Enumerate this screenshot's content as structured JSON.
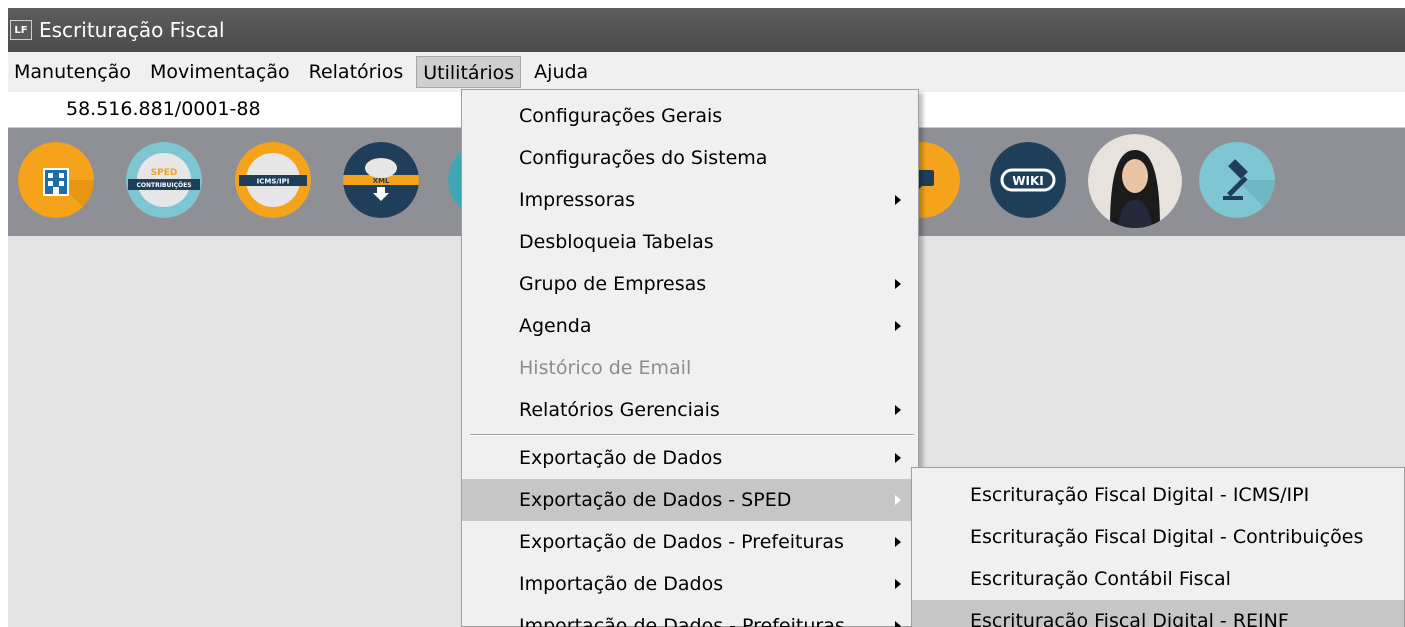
{
  "window": {
    "app_icon_text": "LF",
    "title": "Escrituração Fiscal"
  },
  "menubar": {
    "items": [
      "Manutenção",
      "Movimentação",
      "Relatórios",
      "Utilitários",
      "Ajuda"
    ],
    "active": "Utilitários"
  },
  "company": {
    "cnpj": "58.516.881/0001-88"
  },
  "toolbar": {
    "icons": [
      {
        "name": "building-icon",
        "color": "#f5a31a"
      },
      {
        "name": "sped-contribuicoes-icon",
        "label": "SPED CONTRIBUIÇÕES",
        "color": "#7fc6d3"
      },
      {
        "name": "icms-ipi-icon",
        "label": "ICMS/IPI",
        "color": "#f5a31a"
      },
      {
        "name": "xml-download-icon",
        "label": "XML",
        "color": "#1f3e5a"
      },
      {
        "name": "chat-icon",
        "color": "#f5a31a"
      },
      {
        "name": "wiki-icon",
        "label": "WIKI",
        "color": "#1f3e5a"
      },
      {
        "name": "assistant-avatar-icon",
        "color": "#e6c9a8"
      },
      {
        "name": "gavel-icon",
        "color": "#7fc6d3"
      }
    ]
  },
  "dropdown": {
    "items": [
      {
        "label": "Configurações Gerais",
        "submenu": false
      },
      {
        "label": "Configurações do Sistema",
        "submenu": false
      },
      {
        "label": "Impressoras",
        "submenu": true
      },
      {
        "label": "Desbloqueia Tabelas",
        "submenu": false
      },
      {
        "label": "Grupo de Empresas",
        "submenu": true
      },
      {
        "label": "Agenda",
        "submenu": true
      },
      {
        "label": "Histórico de Email",
        "submenu": false,
        "disabled": true
      },
      {
        "label": "Relatórios Gerenciais",
        "submenu": true
      },
      {
        "label": "Exportação de Dados",
        "submenu": true
      },
      {
        "label": "Exportação de Dados - SPED",
        "submenu": true,
        "highlighted": true
      },
      {
        "label": "Exportação de Dados - Prefeituras",
        "submenu": true
      },
      {
        "label": "Importação de Dados",
        "submenu": true
      },
      {
        "label": "Importação de Dados - Prefeituras",
        "submenu": true
      }
    ]
  },
  "submenu": {
    "items": [
      {
        "label": "Escrituração Fiscal Digital - ICMS/IPI"
      },
      {
        "label": "Escrituração Fiscal Digital - Contribuições"
      },
      {
        "label": "Escrituração Contábil Fiscal"
      },
      {
        "label": "Escrituração Fiscal Digital - REINF",
        "highlighted": true
      }
    ]
  }
}
